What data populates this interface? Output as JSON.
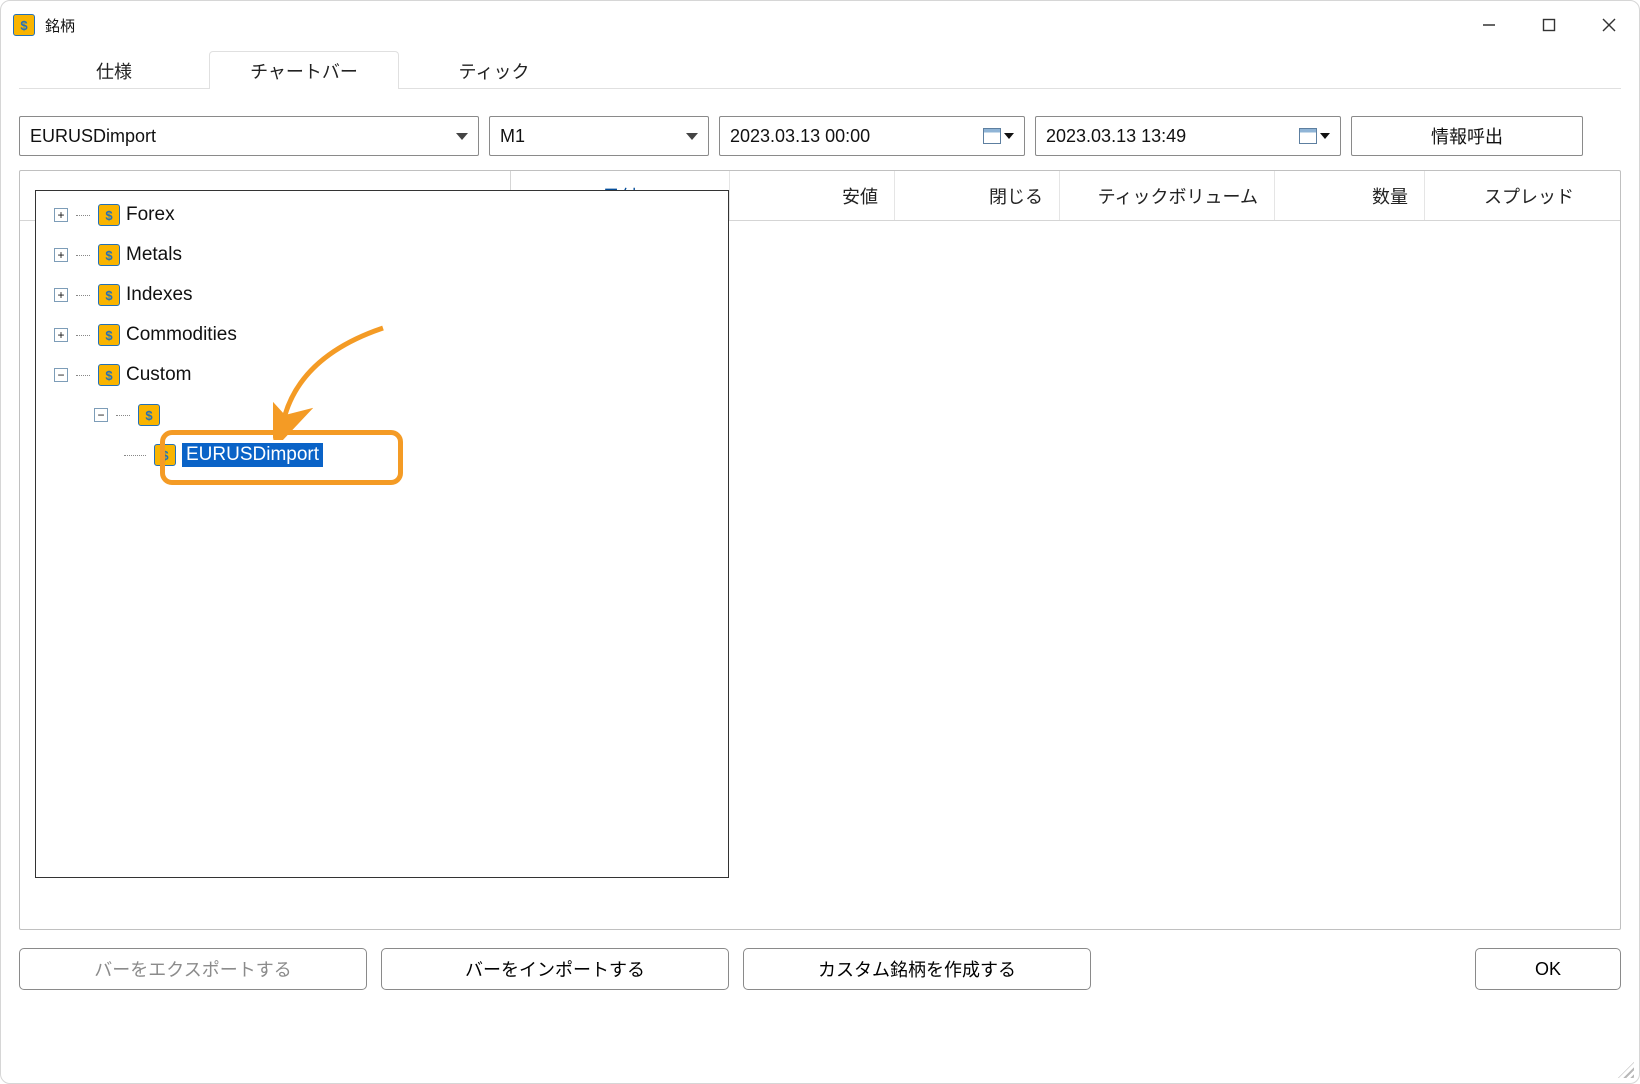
{
  "window": {
    "title": "銘柄"
  },
  "tabs": {
    "spec": "仕様",
    "chart": "チャートバー",
    "tick": "ティック",
    "active": "chart"
  },
  "toolbar": {
    "symbol": "EURUSDimport",
    "timeframe": "M1",
    "from": "2023.03.13 00:00",
    "to": "2023.03.13 13:49",
    "request_label": "情報呼出"
  },
  "tree": {
    "items": [
      {
        "label": "Forex",
        "expandable": true,
        "expanded": false
      },
      {
        "label": "Metals",
        "expandable": true,
        "expanded": false
      },
      {
        "label": "Indexes",
        "expandable": true,
        "expanded": false
      },
      {
        "label": "Commodities",
        "expandable": true,
        "expanded": false
      },
      {
        "label": "Custom",
        "expandable": true,
        "expanded": true,
        "children": [
          {
            "label": "",
            "expandable": true,
            "expanded": true,
            "children": [
              {
                "label": "EURUSDimport",
                "selected": true
              }
            ]
          }
        ]
      }
    ]
  },
  "table": {
    "headers": {
      "date": "日付",
      "low": "安値",
      "close": "閉じる",
      "tickvol": "ティックボリューム",
      "volume": "数量",
      "spread": "スプレッド"
    }
  },
  "buttons": {
    "export": "バーをエクスポートする",
    "import": "バーをインポートする",
    "create": "カスタム銘柄を作成する",
    "ok": "OK"
  }
}
